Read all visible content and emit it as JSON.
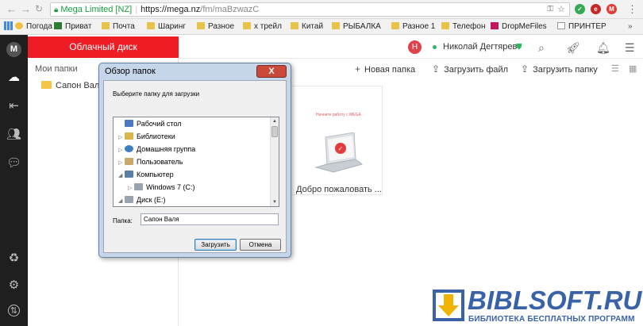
{
  "browser": {
    "url_secure_label": "Mega Limited [NZ]",
    "url_host": "https://mega.nz",
    "url_path": "/fm/maBzwazC",
    "bookmarks": [
      {
        "label": "Погода",
        "color": "#f0c040"
      },
      {
        "label": "Приват",
        "color": "#2e7d32"
      },
      {
        "label": "Почта",
        "color": "#e9c24a"
      },
      {
        "label": "Шаринг",
        "color": "#e9c24a"
      },
      {
        "label": "Разное",
        "color": "#e9c24a"
      },
      {
        "label": "х трейл",
        "color": "#e9c24a"
      },
      {
        "label": "Китай",
        "color": "#e9c24a"
      },
      {
        "label": "РЫБАЛКА",
        "color": "#e9c24a"
      },
      {
        "label": "Разное 1",
        "color": "#e9c24a"
      },
      {
        "label": "Телефон",
        "color": "#e9c24a"
      },
      {
        "label": "DropMeFiles",
        "color": "#c2185b"
      },
      {
        "label": "ПРИНТЕР",
        "color": "#9e9e9e"
      }
    ]
  },
  "mega": {
    "panel_title": "Облачный диск",
    "tree_title": "Мои папки",
    "tree_item": "Сапон Валя",
    "avatar_letter": "Н",
    "username": "Николай Дегтярев",
    "toolbar": {
      "new_folder": "Новая папка",
      "upload_file": "Загрузить файл",
      "upload_folder": "Загрузить папку"
    },
    "card_caption": "Добро пожаловать ...",
    "card_tiny_text": "Начните работу с MEGA"
  },
  "dialog": {
    "title": "Обзор папок",
    "close_label": "X",
    "prompt": "Выберите папку для загрузки",
    "tree": [
      {
        "label": "Рабочий стол",
        "expander": "",
        "icon": "#4a78c2"
      },
      {
        "label": "Библиотеки",
        "expander": "▷",
        "icon": "#d9b54a"
      },
      {
        "label": "Домашняя группа",
        "expander": "▷",
        "icon": "#3d7fc7"
      },
      {
        "label": "Пользователь",
        "expander": "▷",
        "icon": "#c9a86a"
      },
      {
        "label": "Компьютер",
        "expander": "◢",
        "icon": "#5a7ea8"
      },
      {
        "label": "Windows 7 (C:)",
        "expander": "▷",
        "icon": "#9aa4ae"
      },
      {
        "label": "Диск (E:)",
        "expander": "◢",
        "icon": "#9aa4ae"
      }
    ],
    "folder_label": "Папка:",
    "folder_value": "Сапон Валя",
    "ok_label": "Загрузить",
    "cancel_label": "Отмена"
  },
  "watermark": {
    "title": "BIBLSOFT.RU",
    "subtitle": "БИБЛИОТЕКА БЕСПЛАТНЫХ ПРОГРАММ"
  },
  "colors": {
    "mega_red": "#ee1c24",
    "sidebar_dark": "#1f1f1f",
    "watermark_blue": "#3a62a8"
  }
}
